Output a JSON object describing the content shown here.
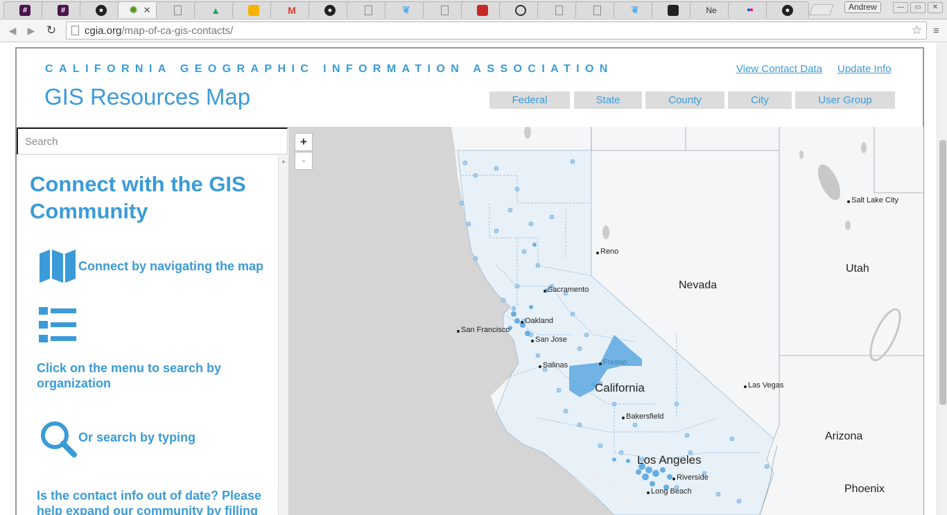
{
  "browser": {
    "tabs": [
      {
        "label": "",
        "icon": "slack-icon"
      },
      {
        "label": "",
        "icon": "slack-icon"
      },
      {
        "label": "",
        "icon": "github-icon"
      },
      {
        "label": "",
        "icon": "green-gear-icon",
        "active": true
      },
      {
        "label": "",
        "icon": "page-icon"
      },
      {
        "label": "",
        "icon": "drive-icon"
      },
      {
        "label": "",
        "icon": "slides-icon"
      },
      {
        "label": "",
        "icon": "gmail-icon"
      },
      {
        "label": "",
        "icon": "github-icon"
      },
      {
        "label": "",
        "icon": "page-icon"
      },
      {
        "label": "",
        "icon": "twitter-icon"
      },
      {
        "label": "",
        "icon": "page-icon"
      },
      {
        "label": "",
        "icon": "red-badge-icon"
      },
      {
        "label": "",
        "icon": "circle-logo-icon"
      },
      {
        "label": "",
        "icon": "page-icon"
      },
      {
        "label": "",
        "icon": "page-icon"
      },
      {
        "label": "",
        "icon": "twitter-icon"
      },
      {
        "label": "",
        "icon": "dark-square-icon"
      },
      {
        "label": "Ne",
        "icon": "none"
      },
      {
        "label": "",
        "icon": "flickr-icon"
      },
      {
        "label": "",
        "icon": "github-icon"
      }
    ],
    "user": "Andrew",
    "url_host": "cgia.org",
    "url_path": "/map-of-ca-gis-contacts/"
  },
  "header": {
    "org_name": "CALIFORNIA GEOGRAPHIC INFORMATION ASSOCIATION",
    "title": "GIS Resources Map",
    "links": {
      "view_contact": "View Contact Data",
      "update_info": "Update Info"
    },
    "categories": [
      "Federal",
      "State",
      "County",
      "City",
      "User Group"
    ]
  },
  "sidebar": {
    "search_placeholder": "Search",
    "heading": "Connect with the GIS Community",
    "items": [
      {
        "label": "Connect by navigating the map",
        "icon": "map-icon"
      },
      {
        "label": "Click on the menu to search by organization",
        "icon": "list-icon"
      },
      {
        "label": "Or search by typing",
        "icon": "magnifier-icon"
      }
    ],
    "footer_text": "Is the contact info out of date? Please help expand our community by filling"
  },
  "map": {
    "zoom_in": "+",
    "zoom_out": "-",
    "labels": {
      "salt_lake": "Salt Lake City",
      "reno": "Reno",
      "utah": "Utah",
      "nevada": "Nevada",
      "sacramento": "Sacramento",
      "oakland": "Oakland",
      "san_francisco": "San Francisco",
      "san_jose": "San Jose",
      "salinas": "Salinas",
      "fresno": "Fresno",
      "california": "California",
      "las_vegas": "Las Vegas",
      "bakersfield": "Bakersfield",
      "arizona": "Arizona",
      "los_angeles": "Los Angeles",
      "riverside": "Riverside",
      "long_beach": "Long Beach",
      "phoenix": "Phoenix"
    },
    "colors": {
      "accent": "#3a9bd8",
      "land": "#f5f6f7",
      "ocean": "#d5d5d5",
      "highlight": "#5aa8e0"
    }
  }
}
